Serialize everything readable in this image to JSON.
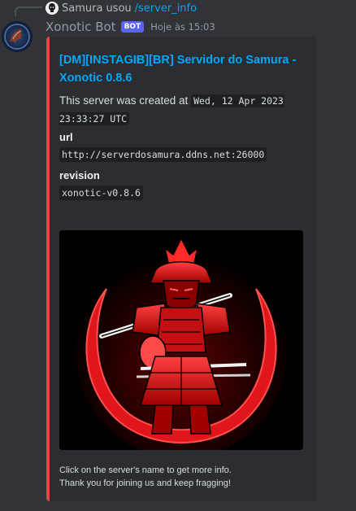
{
  "reply": {
    "user": "Samura",
    "verb": "usou",
    "command": "/server_info"
  },
  "message": {
    "author": "Xonotic Bot",
    "badge": "BOT",
    "timestamp": "Hoje às 15:03"
  },
  "embed": {
    "accent_color": "#f23f43",
    "title": "[DM][INSTAGIB][BR] Servidor do Samura - Xonotic 0.8.6",
    "description_prefix": "This server was created at",
    "description_code": "Wed, 12 Apr 2023 23:33:27 UTC",
    "fields": [
      {
        "name": "url",
        "value": "http://serverdosamura.ddns.net:26000"
      },
      {
        "name": "revision",
        "value": "xonotic-v0.8.6"
      }
    ],
    "footer_line1": "Click on the server's name to get more info.",
    "footer_line2": "Thank you for joining us and keep fragging!"
  },
  "colors": {
    "background": "#313338",
    "embed_background": "#2b2d31",
    "link": "#00a8fc",
    "bot_badge": "#5865f2"
  },
  "icons": {
    "avatar": "xonotic-bot-avatar",
    "reply_avatar": "samura-avatar",
    "embed_image": "samurai-crescent-image"
  }
}
